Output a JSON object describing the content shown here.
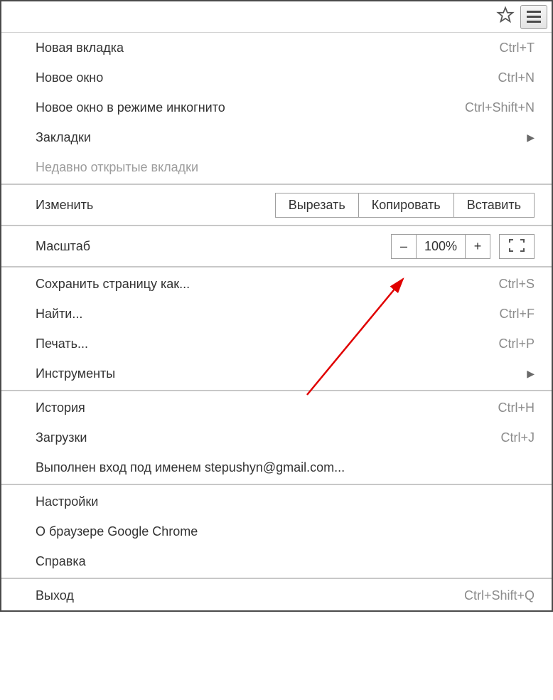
{
  "menu": {
    "new_tab": {
      "label": "Новая вкладка",
      "shortcut": "Ctrl+T"
    },
    "new_window": {
      "label": "Новое окно",
      "shortcut": "Ctrl+N"
    },
    "new_incognito": {
      "label": "Новое окно в режиме инкогнито",
      "shortcut": "Ctrl+Shift+N"
    },
    "bookmarks": {
      "label": "Закладки"
    },
    "recent_tabs": {
      "label": "Недавно открытые вкладки"
    },
    "edit": {
      "label": "Изменить",
      "cut": "Вырезать",
      "copy": "Копировать",
      "paste": "Вставить"
    },
    "zoom": {
      "label": "Масштаб",
      "minus": "–",
      "value": "100%",
      "plus": "+"
    },
    "save_as": {
      "label": "Сохранить страницу как...",
      "shortcut": "Ctrl+S"
    },
    "find": {
      "label": "Найти...",
      "shortcut": "Ctrl+F"
    },
    "print": {
      "label": "Печать...",
      "shortcut": "Ctrl+P"
    },
    "tools": {
      "label": "Инструменты"
    },
    "history": {
      "label": "История",
      "shortcut": "Ctrl+H"
    },
    "downloads": {
      "label": "Загрузки",
      "shortcut": "Ctrl+J"
    },
    "signed_in": {
      "label": "Выполнен вход под именем stepushyn@gmail.com..."
    },
    "settings": {
      "label": "Настройки"
    },
    "about": {
      "label": "О браузере Google Chrome"
    },
    "help": {
      "label": "Справка"
    },
    "exit": {
      "label": "Выход",
      "shortcut": "Ctrl+Shift+Q"
    }
  }
}
